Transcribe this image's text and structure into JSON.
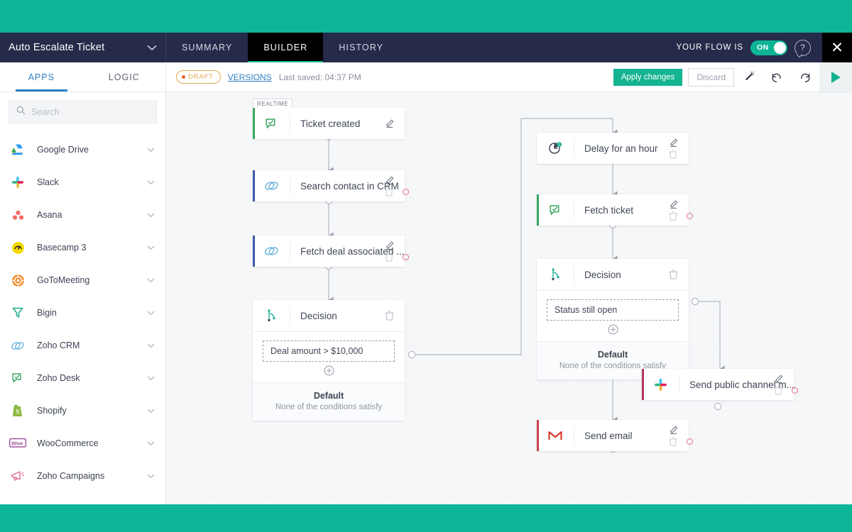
{
  "header": {
    "flow_title": "Auto Escalate Ticket",
    "title_chevron_icon": "chevron-down-icon",
    "tabs": [
      {
        "label": "SUMMARY",
        "active": false
      },
      {
        "label": "BUILDER",
        "active": true
      },
      {
        "label": "HISTORY",
        "active": false
      }
    ],
    "flow_state_label": "YOUR FLOW IS",
    "toggle_state": "ON",
    "help_icon": "help-question-icon",
    "close_icon": "close-icon"
  },
  "subbar": {
    "panel_tabs": [
      {
        "label": "APPS",
        "active": true
      },
      {
        "label": "LOGIC",
        "active": false
      }
    ],
    "draft_badge": "DRAFT",
    "versions_label": "VERSIONS",
    "last_saved": "Last saved: 04:37 PM",
    "apply_label": "Apply changes",
    "discard_label": "Discard",
    "wand_icon": "magic-wand-icon",
    "undo_icon": "undo-icon",
    "redo_icon": "redo-icon",
    "run_icon": "play-icon"
  },
  "sidebar": {
    "search": {
      "value": "",
      "placeholder": "Search",
      "icon": "search-icon"
    },
    "apps": [
      {
        "label": "Google Drive",
        "icon": "google-drive-icon"
      },
      {
        "label": "Slack",
        "icon": "slack-icon"
      },
      {
        "label": "Asana",
        "icon": "asana-icon"
      },
      {
        "label": "Basecamp 3",
        "icon": "basecamp-icon"
      },
      {
        "label": "GoToMeeting",
        "icon": "gotomeeting-icon"
      },
      {
        "label": "Bigin",
        "icon": "bigin-icon"
      },
      {
        "label": "Zoho CRM",
        "icon": "zoho-crm-icon"
      },
      {
        "label": "Zoho Desk",
        "icon": "zoho-desk-icon"
      },
      {
        "label": "Shopify",
        "icon": "shopify-icon"
      },
      {
        "label": "WooCommerce",
        "icon": "woocommerce-icon"
      },
      {
        "label": "Zoho Campaigns",
        "icon": "zoho-campaigns-icon"
      }
    ],
    "expand_icon": "chevron-down-icon"
  },
  "canvas": {
    "trigger_tag": "REALTIME",
    "nodes": {
      "ticket_created": {
        "title": "Ticket created",
        "icon": "zoho-desk-icon",
        "accent": "#3aa75f"
      },
      "search_contact": {
        "title": "Search contact in CRM",
        "icon": "zoho-crm-icon",
        "accent": "#3c5ba8"
      },
      "fetch_deal": {
        "title": "Fetch deal associated ...",
        "icon": "zoho-crm-icon",
        "accent": "#3c5ba8"
      },
      "decision_left": {
        "title": "Decision",
        "icon": "decision-icon"
      },
      "delay": {
        "title": "Delay for an hour",
        "icon": "clock-delay-icon"
      },
      "fetch_ticket": {
        "title": "Fetch ticket",
        "icon": "zoho-desk-icon",
        "accent": "#3aa75f"
      },
      "decision_right": {
        "title": "Decision",
        "icon": "decision-icon"
      },
      "send_slack": {
        "title": "Send public channel m...",
        "icon": "slack-icon",
        "accent": "#b0375c"
      },
      "send_email": {
        "title": "Send email",
        "icon": "gmail-icon",
        "accent": "#c8454a"
      }
    },
    "conditions": {
      "deal_amount": "Deal amount > $10,000",
      "status_open": "Status still open"
    },
    "default_branch": {
      "title": "Default",
      "subtitle": "None of the conditions satisfy"
    },
    "add_condition_icon": "plus-circle-icon",
    "edit_icon": "edit-pencil-icon",
    "delete_icon": "trash-icon"
  },
  "colors": {
    "teal": "#0db596",
    "navy": "#262b4a",
    "accent_blue": "#2e7fc4",
    "draft_orange": "#e0a84f"
  }
}
